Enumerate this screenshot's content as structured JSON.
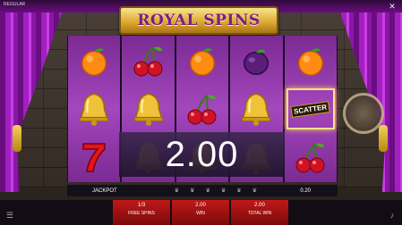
{
  "window": {
    "top_label": "REGULAR",
    "close_glyph": "✕"
  },
  "game": {
    "title": "ROYAL SPINS"
  },
  "reels": [
    [
      "orange",
      "bell",
      "seven"
    ],
    [
      "cherries",
      "bell",
      "bell"
    ],
    [
      "orange",
      "cherries",
      "bell"
    ],
    [
      "plum",
      "bell",
      "bell"
    ],
    [
      "orange",
      "scatter",
      "cherries"
    ]
  ],
  "scatter_label": "SCATTER",
  "win_amount": "2.00",
  "jackpot": {
    "label": "JACKPOT",
    "value": "0.20"
  },
  "stats": {
    "free_spins": {
      "value": "1/3",
      "label": "FREE SPINS"
    },
    "win": {
      "value": "2.00",
      "label": "WIN"
    },
    "total_win": {
      "value": "2.00",
      "label": "TOTAL WIN"
    }
  },
  "colors": {
    "reel_purple": "#a347bd",
    "banner_gold": "#d9a52d",
    "title_purple": "#7a1e86",
    "panel_red": "#c01818"
  }
}
